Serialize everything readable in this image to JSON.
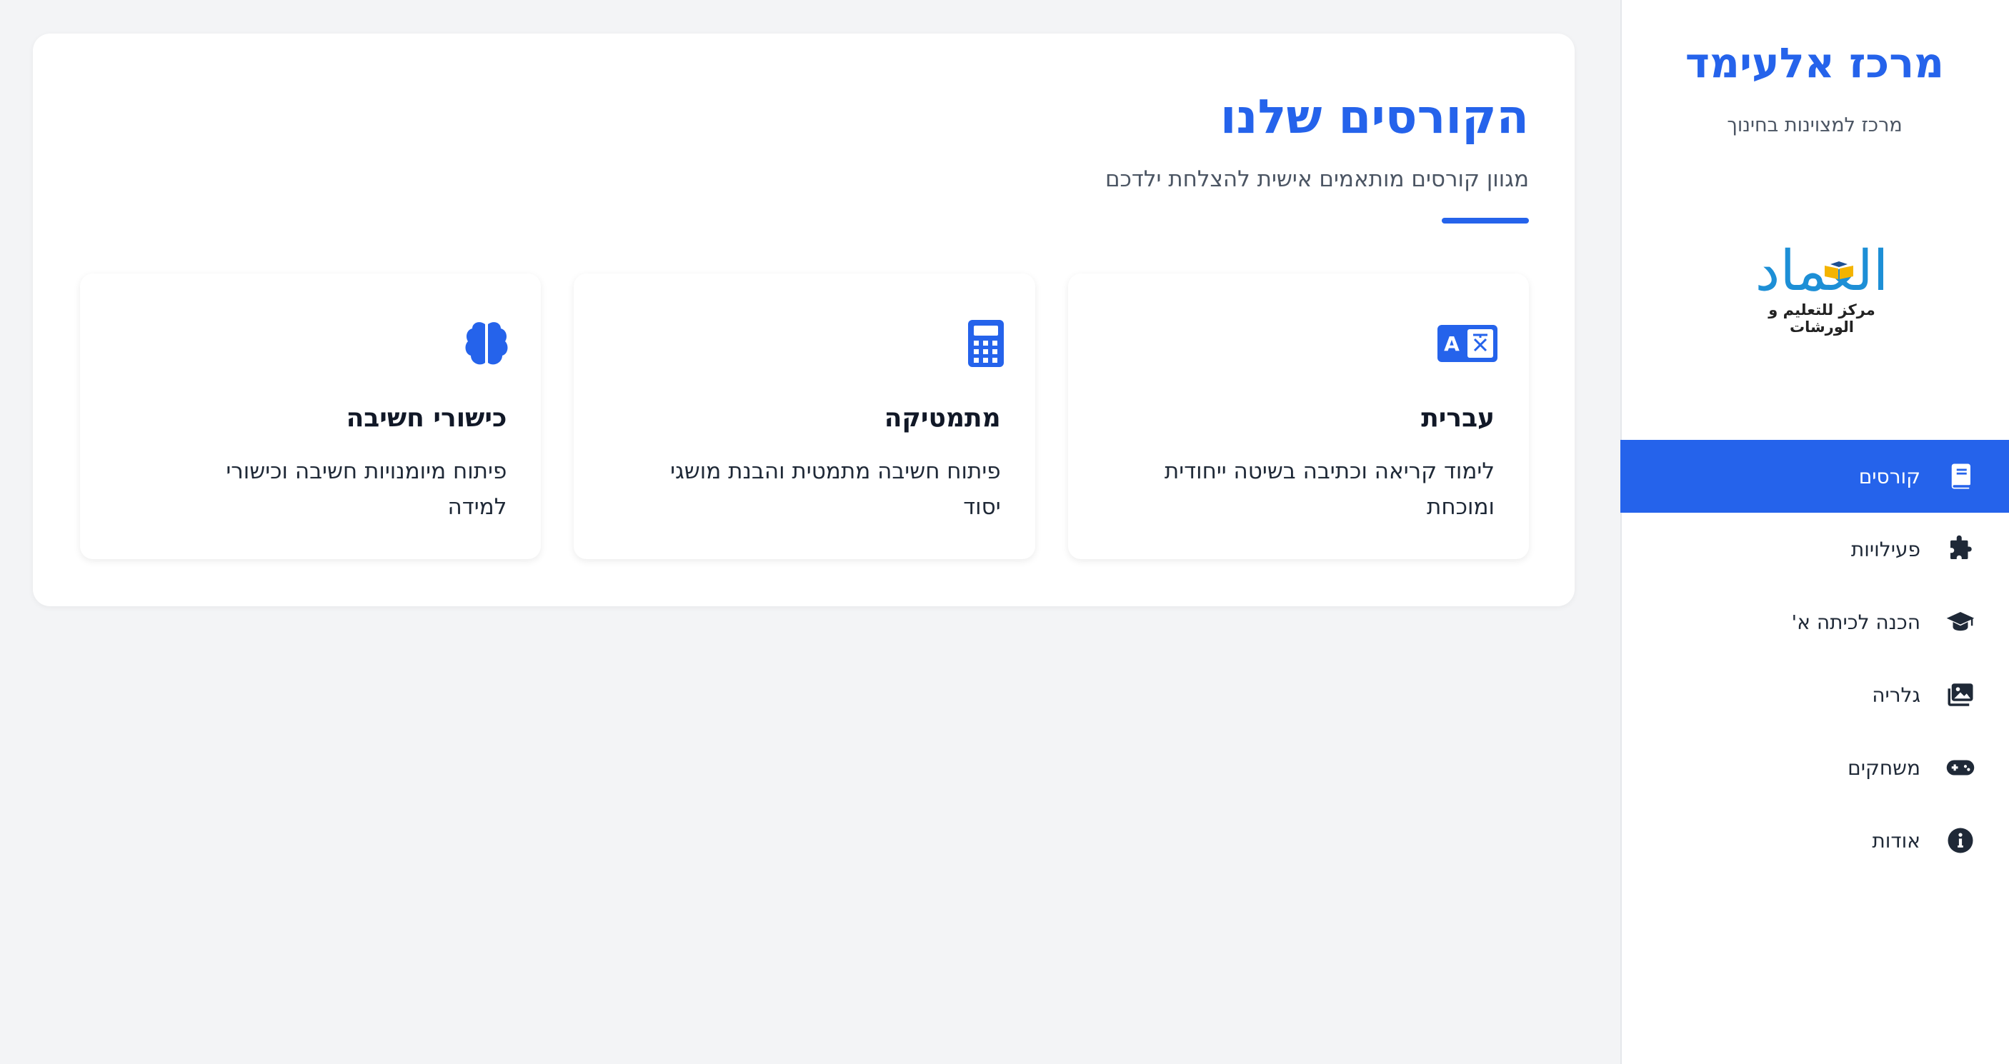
{
  "sidebar": {
    "title": "מרכז אלעימד",
    "subtitle": "מרכז למצוינות בחינוך",
    "logo": {
      "text": "العماد",
      "caption": "مركز للتعليم و الورشات"
    },
    "items": [
      {
        "label": "קורסים",
        "icon": "book-icon",
        "active": true
      },
      {
        "label": "פעילויות",
        "icon": "puzzle-icon",
        "active": false
      },
      {
        "label": "הכנה לכיתה א'",
        "icon": "graduation-cap-icon",
        "active": false
      },
      {
        "label": "גלריה",
        "icon": "images-icon",
        "active": false
      },
      {
        "label": "משחקים",
        "icon": "gamepad-icon",
        "active": false
      },
      {
        "label": "אודות",
        "icon": "info-icon",
        "active": false
      }
    ]
  },
  "main": {
    "title": "הקורסים שלנו",
    "subtitle": "מגוון קורסים מותאמים אישית להצלחת ילדכם",
    "courses": [
      {
        "title": "עברית",
        "description": "לימוד קריאה וכתיבה בשיטה ייחודית ומוכחת",
        "icon": "language-icon"
      },
      {
        "title": "מתמטיקה",
        "description": "פיתוח חשיבה מתמטית והבנת מושגי יסוד",
        "icon": "calculator-icon"
      },
      {
        "title": "כישורי חשיבה",
        "description": "פיתוח מיומנויות חשיבה וכישורי למידה",
        "icon": "brain-icon"
      }
    ]
  },
  "colors": {
    "accent": "#2563eb",
    "background": "#f3f4f6",
    "sidebar_bg": "#ffffff"
  }
}
